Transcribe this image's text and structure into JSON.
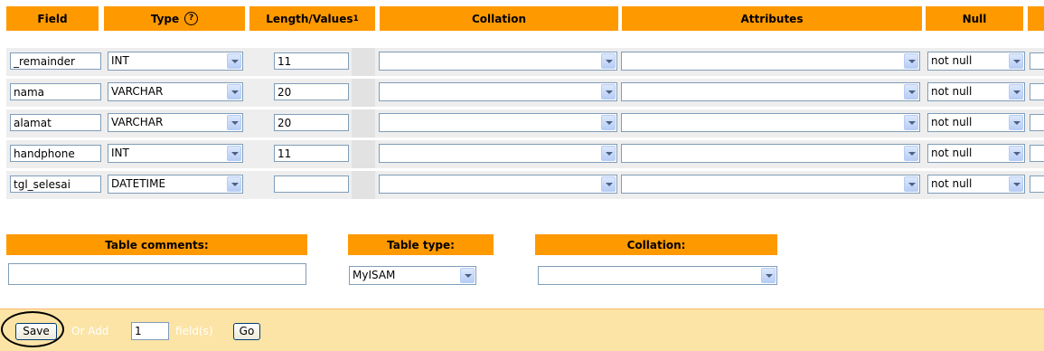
{
  "columns": {
    "field": "Field",
    "type": "Type",
    "length": "Length/Values",
    "length_sup": "1",
    "collation": "Collation",
    "attributes": "Attributes",
    "null": "Null"
  },
  "rows": [
    {
      "field": "_remainder",
      "type": "INT",
      "length": "11",
      "collation": "",
      "attributes": "",
      "null": "not null"
    },
    {
      "field": "nama",
      "type": "VARCHAR",
      "length": "20",
      "collation": "",
      "attributes": "",
      "null": "not null"
    },
    {
      "field": "alamat",
      "type": "VARCHAR",
      "length": "20",
      "collation": "",
      "attributes": "",
      "null": "not null"
    },
    {
      "field": "handphone",
      "type": "INT",
      "length": "11",
      "collation": "",
      "attributes": "",
      "null": "not null"
    },
    {
      "field": "tgl_selesai",
      "type": "DATETIME",
      "length": "",
      "collation": "",
      "attributes": "",
      "null": "not null"
    }
  ],
  "table_options": {
    "comments_label": "Table comments:",
    "comments_value": "",
    "type_label": "Table type:",
    "type_value": "MyISAM",
    "collation_label": "Collation:",
    "collation_value": ""
  },
  "footer": {
    "save_label": "Save",
    "or_add_label": "Or Add",
    "add_count": "1",
    "fields_label": "field(s)",
    "go_label": "Go"
  },
  "colors": {
    "header_bg": "#ff9900",
    "footer_bg": "#fbe4a5",
    "row_bg": "#eeeeee"
  }
}
